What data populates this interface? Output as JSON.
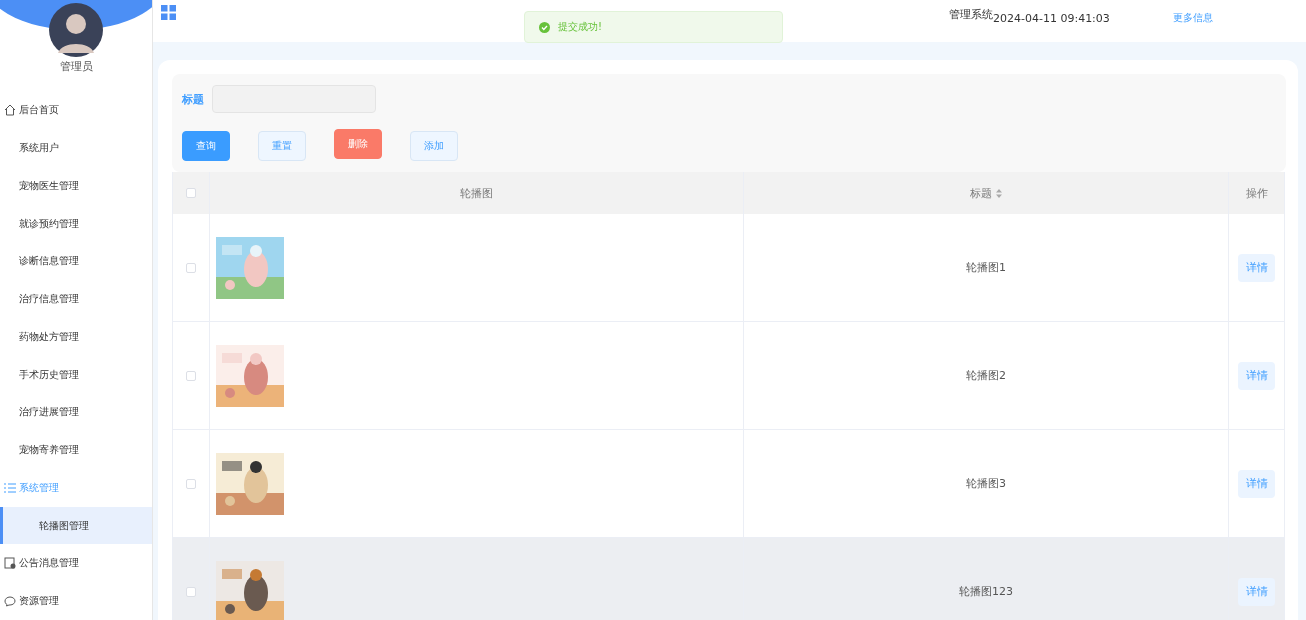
{
  "user": {
    "name": "管理员"
  },
  "menu": [
    {
      "label": "后台首页",
      "expanded": false,
      "selected": false
    },
    {
      "label": "系统用户",
      "expanded": false,
      "selected": false
    },
    {
      "label": "宠物医生管理",
      "expanded": false,
      "selected": false
    },
    {
      "label": "就诊预约管理",
      "expanded": false,
      "selected": false
    },
    {
      "label": "诊断信息管理",
      "expanded": false,
      "selected": false
    },
    {
      "label": "治疗信息管理",
      "expanded": false,
      "selected": false
    },
    {
      "label": "药物处方管理",
      "expanded": false,
      "selected": false
    },
    {
      "label": "手术历史管理",
      "expanded": false,
      "selected": false
    },
    {
      "label": "治疗进展管理",
      "expanded": false,
      "selected": false
    },
    {
      "label": "宠物寄养管理",
      "expanded": false,
      "selected": false
    },
    {
      "label": "系统管理",
      "expanded": true,
      "selected": false,
      "children": [
        {
          "label": "轮播图管理",
          "selected": true
        }
      ]
    },
    {
      "label": "公告消息管理",
      "expanded": false,
      "selected": false
    },
    {
      "label": "资源管理",
      "expanded": false,
      "selected": false
    }
  ],
  "header": {
    "title": "管理系统",
    "datetime": "2024-04-11 09:41:03",
    "link": "更多信息"
  },
  "toast": {
    "message": "提交成功!"
  },
  "search": {
    "label": "标题"
  },
  "buttons": [
    {
      "label": "查询",
      "kind": "primary"
    },
    {
      "label": "重置",
      "kind": "plain"
    },
    {
      "label": "删除",
      "kind": "danger"
    },
    {
      "label": "添加",
      "kind": "plain"
    }
  ],
  "table": {
    "all_checked": false,
    "columns": [
      {
        "label": "轮播图",
        "sortable": false
      },
      {
        "label": "标题",
        "sortable": true
      },
      {
        "label": "操作",
        "sortable": false
      }
    ],
    "rows": [
      {
        "checked": false,
        "title": "轮播图1",
        "action": "详情",
        "hovered": false
      },
      {
        "checked": false,
        "title": "轮播图2",
        "action": "详情",
        "hovered": false
      },
      {
        "checked": false,
        "title": "轮播图3",
        "action": "详情",
        "hovered": false
      },
      {
        "checked": false,
        "title": "轮播图123",
        "action": "详情",
        "hovered": true
      }
    ]
  }
}
